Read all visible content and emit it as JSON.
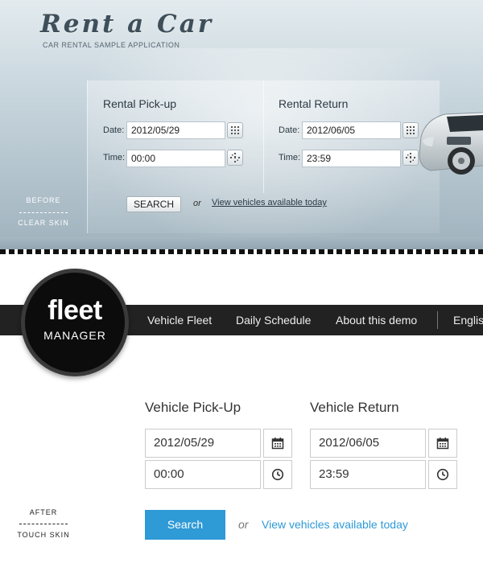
{
  "before_skin": {
    "logo_title": "Rent a Car",
    "logo_subtitle": "CAR RENTAL SAMPLE APPLICATION",
    "pickup": {
      "heading": "Rental Pick-up",
      "date_label": "Date:",
      "date_value": "2012/05/29",
      "time_label": "Time:",
      "time_value": "00:00"
    },
    "return": {
      "heading": "Rental Return",
      "date_label": "Date:",
      "date_value": "2012/06/05",
      "time_label": "Time:",
      "time_value": "23:59"
    },
    "search_label": "SEARCH",
    "or_label": "or",
    "available_link": "View vehicles available today",
    "skin_top_label": "BEFORE",
    "skin_bottom_label": "CLEAR SKIN",
    "colors": {
      "background": "#c6d4dc",
      "text": "#2d3a43"
    }
  },
  "after_skin": {
    "logo_word": "fleet",
    "logo_subtitle": "MANAGER",
    "nav": [
      "Vehicle Fleet",
      "Daily Schedule",
      "About this demo",
      "Englis"
    ],
    "pickup": {
      "heading": "Vehicle Pick-Up",
      "date_value": "2012/05/29",
      "time_value": "00:00"
    },
    "return": {
      "heading": "Vehicle Return",
      "date_value": "2012/06/05",
      "time_value": "23:59"
    },
    "search_label": "Search",
    "or_label": "or",
    "available_link": "View vehicles available today",
    "skin_top_label": "AFTER",
    "skin_bottom_label": "TOUCH SKIN",
    "icons": {
      "date": "calendar-icon",
      "time": "clock-icon"
    },
    "colors": {
      "nav_bg": "#222222",
      "accent": "#2e9ad6"
    }
  }
}
